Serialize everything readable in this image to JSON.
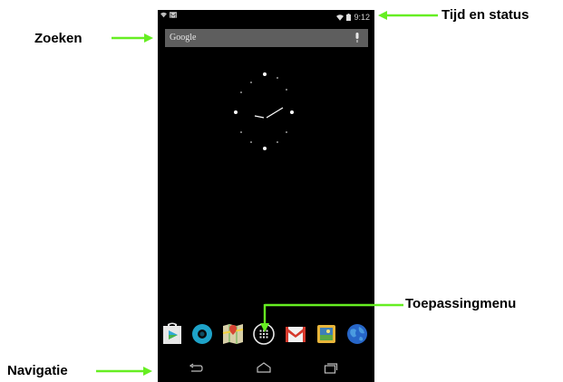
{
  "status_bar": {
    "time": "9:12",
    "left_icons": [
      "wifi-question-icon",
      "gmail-notification-icon"
    ],
    "right_icons": [
      "wifi-icon",
      "battery-icon"
    ]
  },
  "search": {
    "label": "Google",
    "mic_icon": "microphone-icon"
  },
  "dock": {
    "apps": [
      "play-store-icon",
      "camera-lens-icon",
      "maps-icon",
      "app-drawer-icon",
      "gmail-icon",
      "photo-app-icon",
      "earth-icon"
    ]
  },
  "navigation": {
    "buttons": [
      "back-icon",
      "home-icon",
      "recent-apps-icon"
    ]
  },
  "callouts": {
    "time_status": "Tijd en status",
    "search": "Zoeken",
    "apps_menu": "Toepassingmenu",
    "navigation": "Navigatie"
  },
  "colors": {
    "arrow": "#66ee22",
    "screen_bg": "#000000",
    "search_bg": "#5e5e5e"
  }
}
